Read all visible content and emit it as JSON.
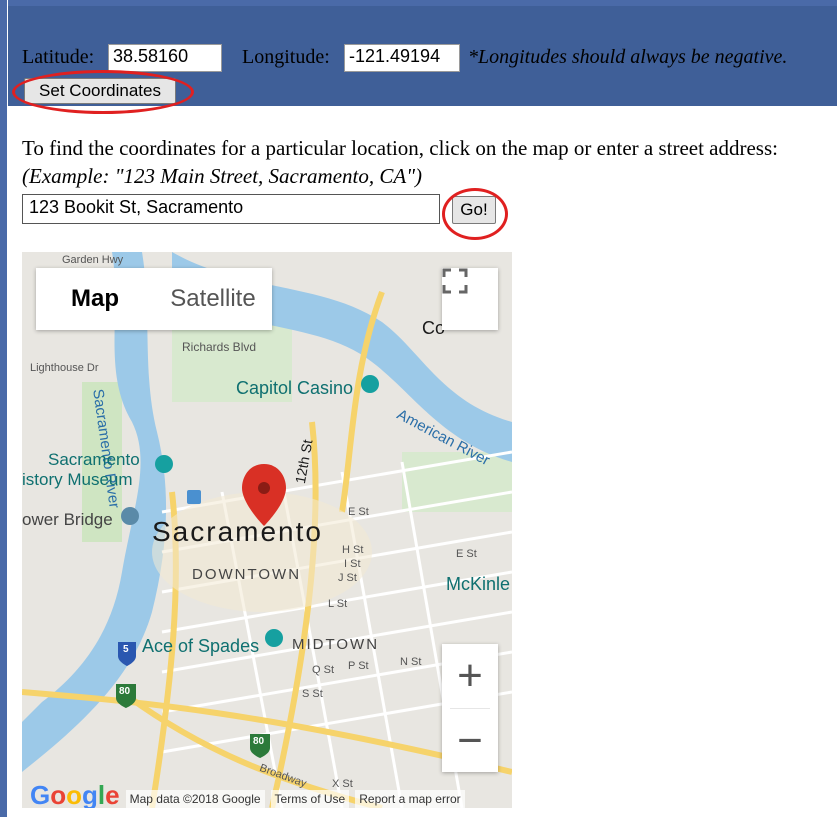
{
  "coords": {
    "latitude_label": "Latitude:",
    "latitude_value": "38.58160",
    "longitude_label": "Longitude:",
    "longitude_value": "-121.49194",
    "note": "*Longitudes should always be negative.",
    "set_button": "Set Coordinates"
  },
  "address": {
    "instruction": "To find the coordinates for a particular location, click on the map or enter a street address:",
    "example": "(Example: \"123 Main Street, Sacramento, CA\")",
    "value": "123 Bookit St, Sacramento",
    "go_button": "Go!"
  },
  "map": {
    "type_map": "Map",
    "type_satellite": "Satellite",
    "zoom_in": "+",
    "zoom_out": "−",
    "labels": {
      "city": "Sacramento",
      "downtown": "DOWNTOWN",
      "midtown": "MIDTOWN",
      "capitol_casino": "Capitol Casino",
      "american_river": "American River",
      "history_museum_1": "Sacramento",
      "history_museum_2": "istory Museum",
      "tower_bridge": "ower Bridge",
      "ace_of_spades": "Ace of Spades",
      "mckinley": "McKinle",
      "richards": "Richards Blvd",
      "street_12th": "12th St",
      "garden": "Garden Hwy",
      "lighthouse": "Lighthouse Dr",
      "sacramento_river": "Sacramento River",
      "co": "Co",
      "hwy_5": "5",
      "hwy_80a": "80",
      "hwy_80b": "80",
      "e_st": "E St",
      "h_st": "H St",
      "i_st": "I St",
      "j_st": "J St",
      "l_st": "L St",
      "n_st": "N St",
      "q_st": "Q St",
      "p_st": "P St",
      "s_st": "S St",
      "x_st": "X St",
      "broadway": "Broadway",
      "e_st2": "E St"
    },
    "google": "Google",
    "attribution": "Map data ©2018 Google",
    "terms": "Terms of Use",
    "report": "Report a map error"
  },
  "colors": {
    "coord_bar": "#3f5f98",
    "annotation_red": "#e02020",
    "marker_red": "#d93025",
    "river": "#9cc9e8",
    "road_major": "#f6d36b"
  }
}
